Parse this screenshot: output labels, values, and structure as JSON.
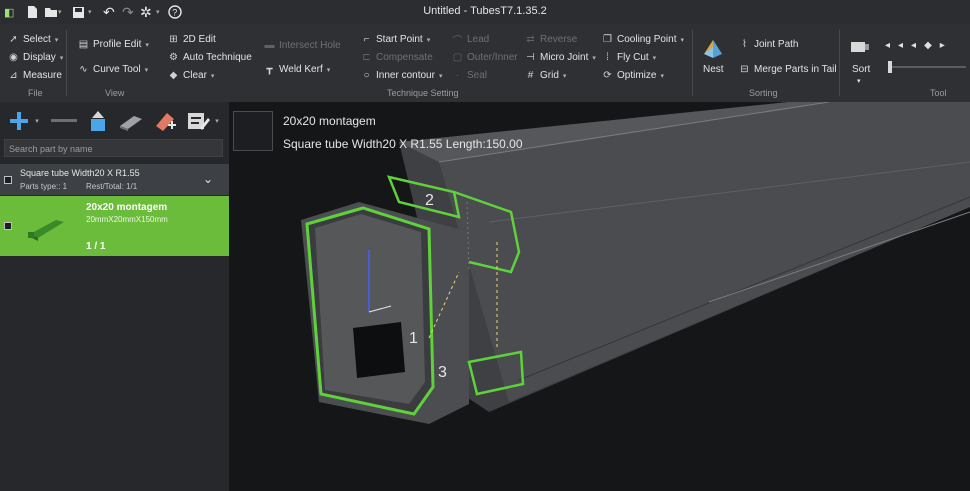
{
  "app": {
    "title": "Untitled - TubesT7.1.35.2"
  },
  "quick_access": [
    {
      "name": "new-file-icon",
      "glyph": "▯"
    },
    {
      "name": "open-folder-icon",
      "glyph": "▭"
    },
    {
      "name": "save-icon",
      "glyph": "▪"
    },
    {
      "name": "undo-icon",
      "glyph": "↶"
    },
    {
      "name": "redo-icon",
      "glyph": "↷"
    },
    {
      "name": "settings-gear-icon",
      "glyph": "✲"
    },
    {
      "name": "help-icon",
      "glyph": "?"
    }
  ],
  "ribbon": {
    "file": {
      "group": "File",
      "select": "Select",
      "display": "Display",
      "measure": "Measure"
    },
    "view": {
      "group": "View",
      "profile_edit": "Profile Edit",
      "curve_tool": "Curve Tool"
    },
    "edit2d": {
      "edit": "2D Edit",
      "auto_technique": "Auto Technique",
      "clear": "Clear"
    },
    "weld": {
      "intersect_hole": "Intersect Hole",
      "weld_kerf": "Weld Kerf"
    },
    "technique": {
      "group": "Technique Setting",
      "start_point": "Start Point",
      "compensate": "Compensate",
      "inner_contour": "Inner contour",
      "lead": "Lead",
      "outer_inner": "Outer/Inner",
      "seal": "Seal",
      "reverse": "Reverse",
      "micro_joint": "Micro Joint",
      "grid": "Grid",
      "cooling_point": "Cooling Point",
      "fly_cut": "Fly Cut",
      "optimize": "Optimize"
    },
    "sorting": {
      "group": "Sorting",
      "nest": "Nest",
      "joint_path": "Joint Path",
      "merge_parts": "Merge Parts in Tail"
    },
    "tool": {
      "group": "Tool",
      "sort": "Sort"
    }
  },
  "left_panel": {
    "search_placeholder": "Search part by name",
    "group": {
      "title": "Square tube Width20 X R1.55",
      "parts_type": "Parts type:: 1",
      "rest_total": "Rest/Total: 1/1"
    },
    "part": {
      "name": "20x20 montagem",
      "size": "20mmX20mmX150mm",
      "count": "1 / 1"
    }
  },
  "viewport": {
    "part_name": "20x20 montagem",
    "part_desc": "Square tube Width20 X R1.55 Length:150.00",
    "labels": {
      "one": "1",
      "two": "2",
      "three": "3"
    }
  },
  "colors": {
    "accent_green": "#5fd13a",
    "selected_row": "#6abc3a",
    "ribbon_bg": "#2e3034"
  }
}
